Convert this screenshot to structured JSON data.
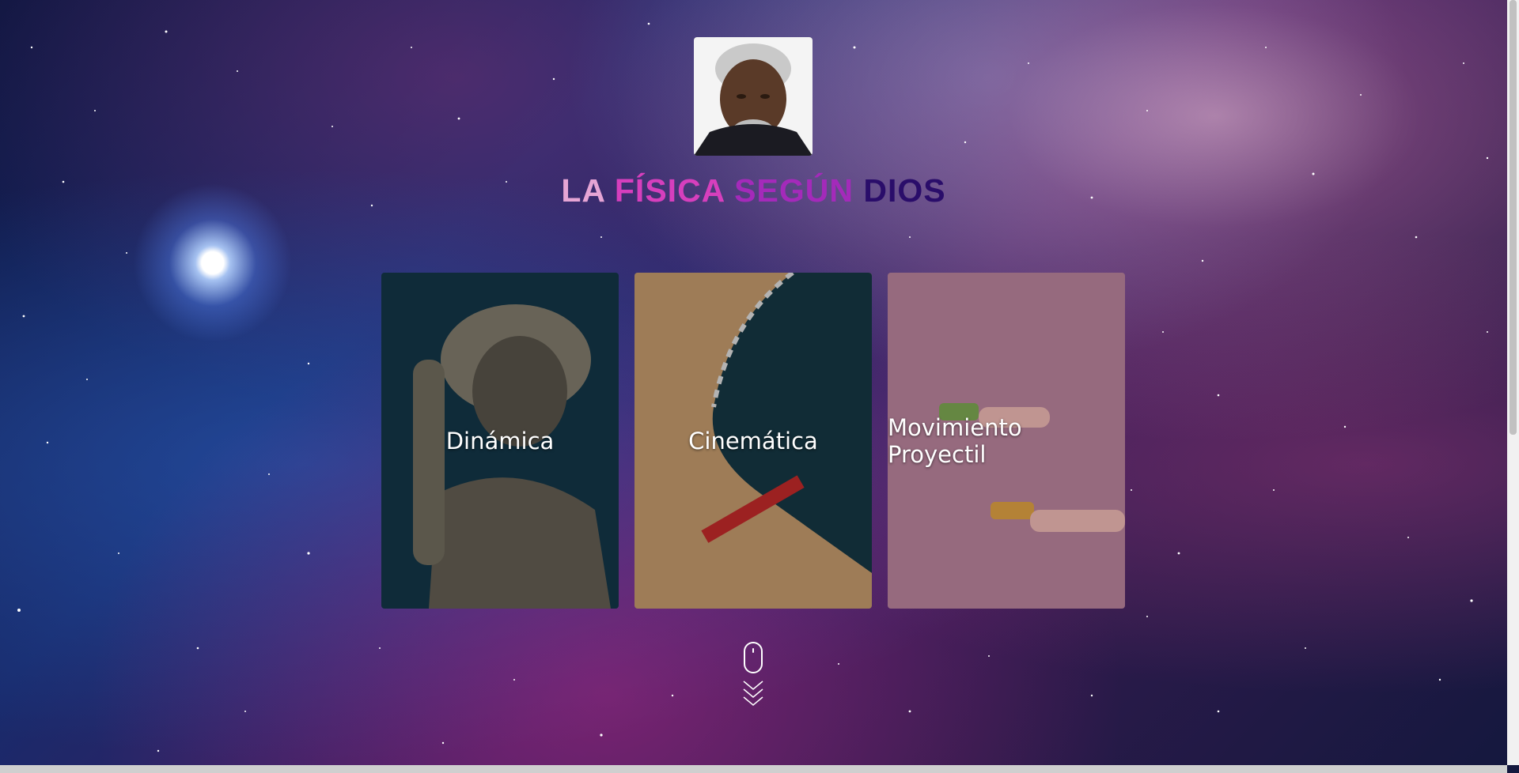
{
  "header": {
    "avatar_alt": "avatar",
    "title_words": [
      "LA",
      "FÍSICA",
      "SEGÚN",
      "DIOS"
    ]
  },
  "cards": [
    {
      "label": "Dinámica"
    },
    {
      "label": "Cinemática"
    },
    {
      "label": "Movimiento Proyectil"
    }
  ],
  "scroll_indicator": {
    "icon": "mouse-scroll-icon"
  },
  "colors": {
    "title_word_1": "#e6a5d5",
    "title_word_2": "#d63fbd",
    "title_word_3": "#a42aba",
    "title_word_4": "#2a0d6a"
  }
}
